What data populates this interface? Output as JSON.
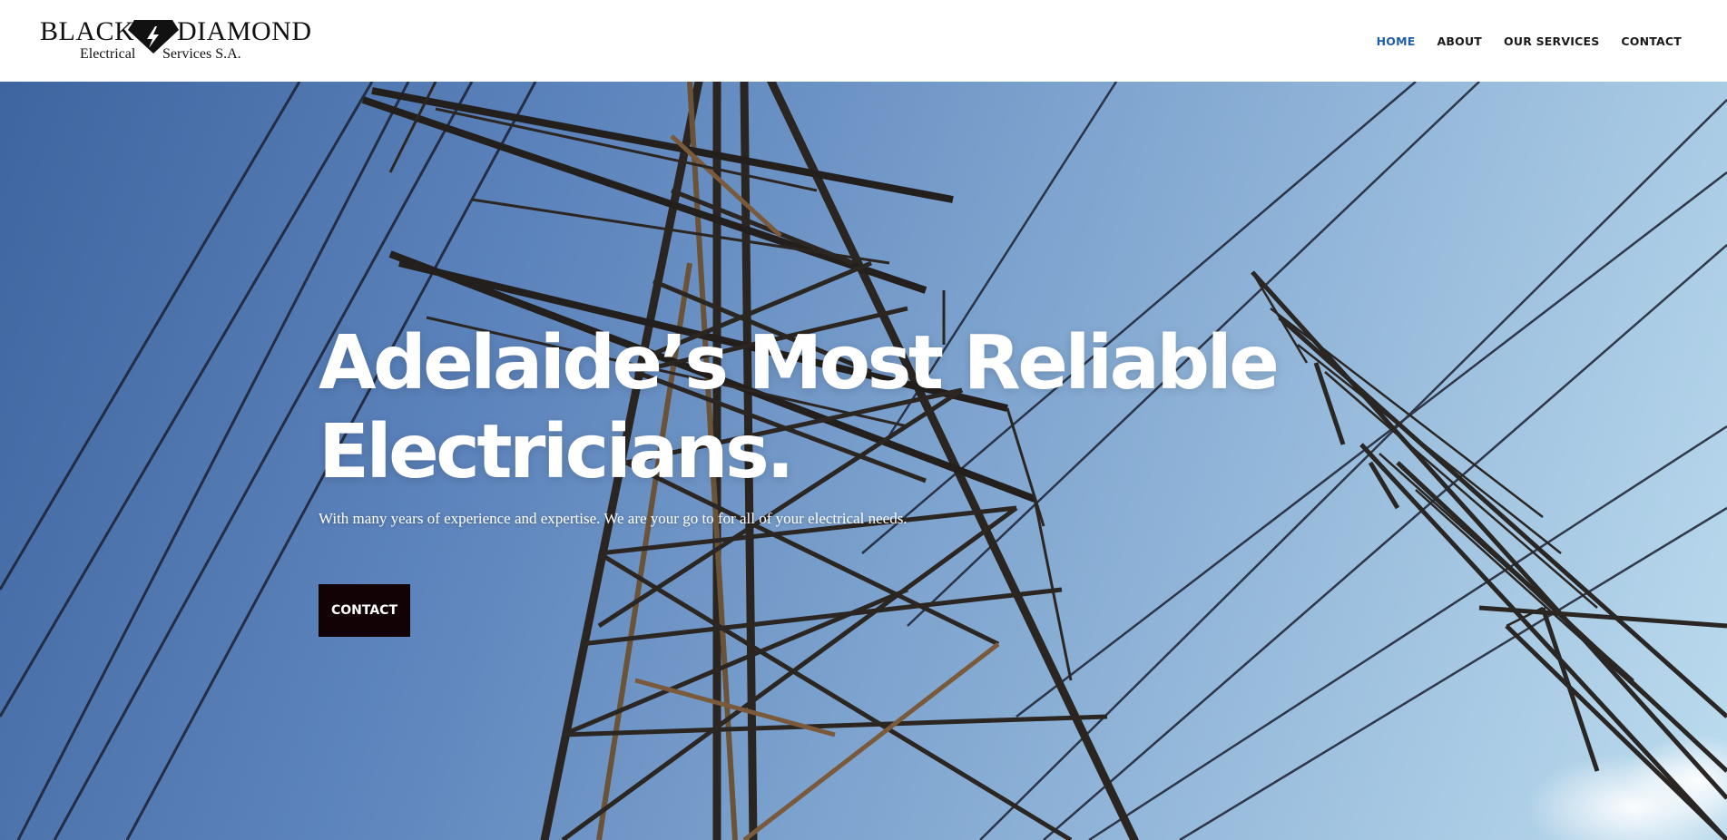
{
  "logo": {
    "word1": "BLACK",
    "word2": "DIAMOND",
    "sub1": "Electrical",
    "sub2": "Services S.A."
  },
  "nav": {
    "items": [
      {
        "label": "HOME",
        "active": true
      },
      {
        "label": "ABOUT",
        "active": false
      },
      {
        "label": "OUR SERVICES",
        "active": false
      },
      {
        "label": "CONTACT",
        "active": false
      }
    ]
  },
  "hero": {
    "title_line1": "Adelaide’s Most Reliable",
    "title_line2": "Electricians.",
    "subtitle": "With many years of experience and expertise. We are your go to for all of your electrical needs.",
    "button_label": "CONTACT"
  },
  "colors": {
    "nav_active": "#1e5fa8",
    "nav_text": "#1a1a1a",
    "button_bg": "#120206",
    "sky_dark": "#3f65a0",
    "sky_light": "#bcdcee"
  }
}
